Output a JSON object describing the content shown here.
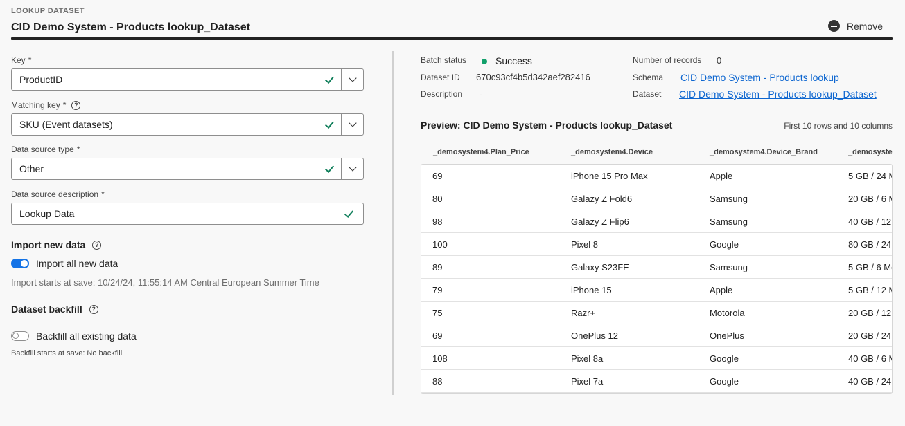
{
  "header": {
    "section_label": "LOOKUP DATASET",
    "title": "CID Demo System - Products lookup_Dataset",
    "remove_label": "Remove"
  },
  "form": {
    "key": {
      "label": "Key",
      "required": "*",
      "value": "ProductID"
    },
    "matching_key": {
      "label": "Matching key",
      "required": "*",
      "value": "SKU (Event datasets)"
    },
    "data_source_type": {
      "label": "Data source type",
      "required": "*",
      "value": "Other"
    },
    "data_source_description": {
      "label": "Data source description",
      "required": "*",
      "value": "Lookup Data"
    },
    "import": {
      "heading": "Import new data",
      "toggle_label": "Import all new data",
      "toggle_on": true,
      "hint": "Import starts at save: 10/24/24, 11:55:14 AM Central European Summer Time"
    },
    "backfill": {
      "heading": "Dataset backfill",
      "toggle_label": "Backfill all existing data",
      "toggle_on": false,
      "hint": "Backfill starts at save: No backfill"
    }
  },
  "meta": {
    "batch_status_label": "Batch status",
    "batch_status_value": "Success",
    "dataset_id_label": "Dataset ID",
    "dataset_id_value": "670c93cf4b5d342aef282416",
    "description_label": "Description",
    "description_value": "-",
    "records_label": "Number of records",
    "records_value": "0",
    "schema_label": "Schema",
    "schema_link": "CID Demo System - Products lookup",
    "dataset_label": "Dataset",
    "dataset_link": "CID Demo System - Products lookup_Dataset"
  },
  "preview": {
    "title": "Preview: CID Demo System - Products lookup_Dataset",
    "note": "First 10 rows and 10 columns",
    "columns": [
      "_demosystem4.Plan_Price",
      "_demosystem4.Device",
      "_demosystem4.Device_Brand",
      "_demosystem"
    ],
    "rows": [
      [
        "69",
        "iPhone 15 Pro Max",
        "Apple",
        "5 GB / 24 M"
      ],
      [
        "80",
        "Galazy Z Fold6",
        "Samsung",
        "20 GB / 6 M"
      ],
      [
        "98",
        "Galazy Z Flip6",
        "Samsung",
        "40 GB / 12 I"
      ],
      [
        "100",
        "Pixel 8",
        "Google",
        "80 GB / 24"
      ],
      [
        "89",
        "Galaxy S23FE",
        "Samsung",
        "5 GB / 6 Mo"
      ],
      [
        "79",
        "iPhone 15",
        "Apple",
        "5 GB / 12 M"
      ],
      [
        "75",
        "Razr+",
        "Motorola",
        "20 GB / 12 M"
      ],
      [
        "69",
        "OnePlus 12",
        "OnePlus",
        "20 GB / 24"
      ],
      [
        "108",
        "Pixel 8a",
        "Google",
        "40 GB / 6 M"
      ],
      [
        "88",
        "Pixel 7a",
        "Google",
        "40 GB / 24"
      ]
    ]
  },
  "colors": {
    "accent": "#1473e6",
    "success": "#12805c",
    "link": "#0d66d0"
  }
}
